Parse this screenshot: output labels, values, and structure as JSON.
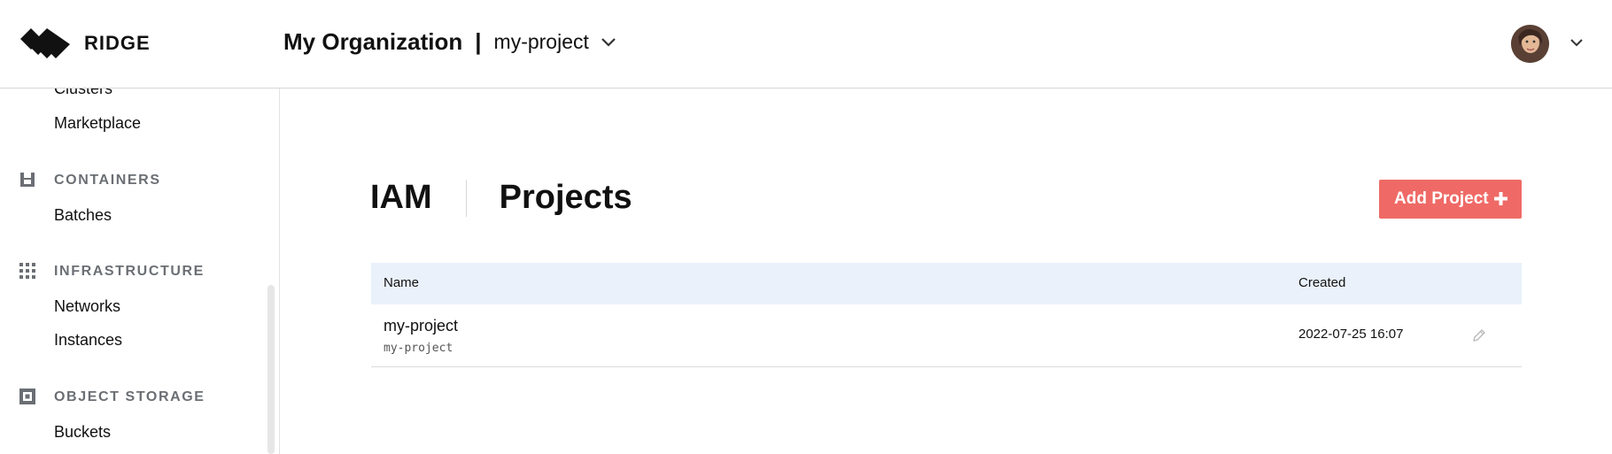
{
  "header": {
    "logo_text": "RIDGE",
    "org_name": "My Organization",
    "separator": "|",
    "project_name": "my-project",
    "icons": [
      "ridge-logo-icon",
      "chevron-down-icon",
      "avatar",
      "chevron-down-icon"
    ]
  },
  "sidebar": {
    "items_top": [
      {
        "label": "Clusters"
      },
      {
        "label": "Marketplace"
      }
    ],
    "sections": [
      {
        "title": "CONTAINERS",
        "icon": "container-icon",
        "items": [
          {
            "label": "Batches"
          }
        ]
      },
      {
        "title": "INFRASTRUCTURE",
        "icon": "grid-dots-icon",
        "items": [
          {
            "label": "Networks"
          },
          {
            "label": "Instances"
          }
        ]
      },
      {
        "title": "OBJECT STORAGE",
        "icon": "storage-icon",
        "items": [
          {
            "label": "Buckets"
          }
        ]
      }
    ]
  },
  "main": {
    "tabs": [
      {
        "label": "IAM"
      },
      {
        "label": "Projects"
      }
    ],
    "add_button_label": "Add Project",
    "table": {
      "columns": [
        "Name",
        "Created"
      ],
      "rows": [
        {
          "name": "my-project",
          "id": "my-project",
          "created": "2022-07-25 16:07"
        }
      ]
    }
  },
  "colors": {
    "accent": "#ef6a66",
    "table_header_bg": "#eaf1fb",
    "section_title": "#6b6f74"
  }
}
